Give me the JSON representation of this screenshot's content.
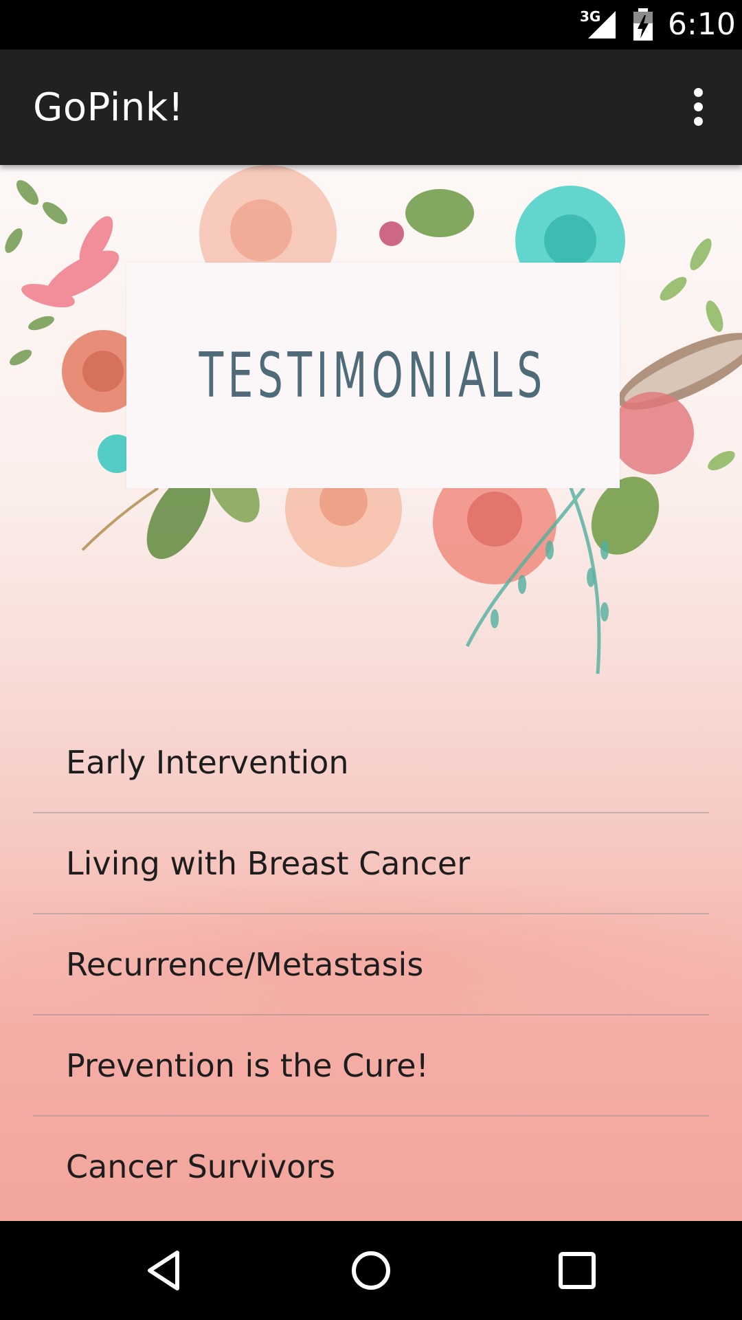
{
  "status_bar": {
    "network": "3G",
    "time": "6:10"
  },
  "app_bar": {
    "title": "GoPink!"
  },
  "banner": {
    "heading": "TESTIMONIALS"
  },
  "menu": {
    "items": [
      {
        "label": "Early Intervention"
      },
      {
        "label": "Living with Breast Cancer"
      },
      {
        "label": "Recurrence/Metastasis"
      },
      {
        "label": "Prevention is the Cure!"
      },
      {
        "label": "Cancer Survivors"
      }
    ]
  },
  "colors": {
    "app_bar": "#212121",
    "text": "#1d1d1d",
    "heading": "#4f6a78",
    "pink": "#f3a59c"
  },
  "icons": [
    "signal-icon",
    "battery-icon",
    "overflow-menu-icon",
    "back-icon",
    "home-icon",
    "recents-icon"
  ]
}
